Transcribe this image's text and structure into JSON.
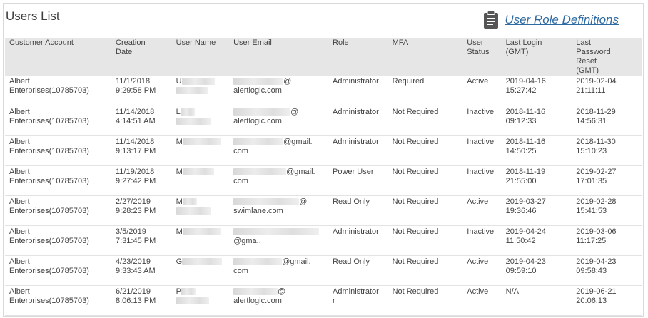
{
  "header": {
    "title": "Users List",
    "role_defs_label": "User Role Definitions",
    "role_defs_icon": "clipboard-icon"
  },
  "table": {
    "columns": [
      [
        "Customer Account"
      ],
      [
        "Creation",
        "Date"
      ],
      [
        "User Name"
      ],
      [
        "User Email"
      ],
      [
        "Role"
      ],
      [
        "MFA"
      ],
      [
        "User",
        "Status"
      ],
      [
        "Last Login",
        "(GMT)"
      ],
      [
        "Last",
        "Password",
        "Reset",
        "(GMT)"
      ]
    ],
    "rows": [
      {
        "account": [
          "Albert",
          "Enterprises(10785703)"
        ],
        "created": [
          "11/1/2018",
          "9:29:58 PM"
        ],
        "user_initial": "U",
        "email": [
          "@",
          "alertlogic.com"
        ],
        "role": "Administrator",
        "mfa": "Required",
        "status": "Active",
        "last_login": [
          "2019-04-16",
          "15:27:42"
        ],
        "last_reset": [
          "2019-02-04",
          "21:11:11"
        ]
      },
      {
        "account": [
          "Albert",
          "Enterprises(10785703)"
        ],
        "created": [
          "11/14/2018",
          "4:14:51 AM"
        ],
        "user_initial": "L",
        "email": [
          "@",
          "alertlogic.com"
        ],
        "role": "Administrator",
        "mfa": "Not Required",
        "status": "Inactive",
        "last_login": [
          "2018-11-16",
          "09:12:33"
        ],
        "last_reset": [
          "2018-11-29",
          "14:56:31"
        ]
      },
      {
        "account": [
          "Albert",
          "Enterprises(10785703)"
        ],
        "created": [
          "11/14/2018",
          "9:13:17 PM"
        ],
        "user_initial": "M",
        "email": [
          "@gmail.",
          "com"
        ],
        "role": "Administrator",
        "mfa": "Not Required",
        "status": "Inactive",
        "last_login": [
          "2018-11-16",
          "14:50:25"
        ],
        "last_reset": [
          "2018-11-30",
          "15:10:23"
        ]
      },
      {
        "account": [
          "Albert",
          "Enterprises(10785703)"
        ],
        "created": [
          "11/19/2018",
          "9:27:42 PM"
        ],
        "user_initial": "M",
        "email": [
          "@gmail.",
          "com"
        ],
        "role": "Power User",
        "mfa": "Not Required",
        "status": "Inactive",
        "last_login": [
          "2018-11-19",
          "21:55:00"
        ],
        "last_reset": [
          "2019-02-27",
          "17:01:35"
        ]
      },
      {
        "account": [
          "Albert",
          "Enterprises(10785703)"
        ],
        "created": [
          "2/27/2019",
          "9:28:23 PM"
        ],
        "user_initial": "M",
        "email": [
          "@",
          "swimlane.com"
        ],
        "role": "Read Only",
        "mfa": "Not Required",
        "status": "Active",
        "last_login": [
          "2019-03-27",
          "19:36:46"
        ],
        "last_reset": [
          "2019-02-28",
          "15:41:53"
        ]
      },
      {
        "account": [
          "Albert",
          "Enterprises(10785703)"
        ],
        "created": [
          "3/5/2019",
          "7:31:45 PM"
        ],
        "user_initial": "M",
        "email": [
          "",
          "@gma.."
        ],
        "role": "Administrator",
        "mfa": "Not Required",
        "status": "Inactive",
        "last_login": [
          "2019-04-24",
          "11:50:42"
        ],
        "last_reset": [
          "2019-03-06",
          "11:17:25"
        ]
      },
      {
        "account": [
          "Albert",
          "Enterprises(10785703)"
        ],
        "created": [
          "4/23/2019",
          "9:33:43 AM"
        ],
        "user_initial": "G",
        "email": [
          "@gmail.",
          "com"
        ],
        "role": "Read Only",
        "mfa": "Not Required",
        "status": "Active",
        "last_login": [
          "2019-04-23",
          "09:59:10"
        ],
        "last_reset": [
          "2019-04-23",
          "09:58:43"
        ]
      },
      {
        "account": [
          "Albert",
          "Enterprises(10785703)"
        ],
        "created": [
          "6/21/2019",
          "8:06:13 PM"
        ],
        "user_initial": "P",
        "email": [
          "@",
          "alertlogic.com"
        ],
        "role": "Administrator\nr",
        "mfa": "Not Required",
        "status": "Active",
        "last_login": [
          "N/A",
          ""
        ],
        "last_reset": [
          "2019-06-21",
          "20:06:13"
        ]
      }
    ]
  }
}
